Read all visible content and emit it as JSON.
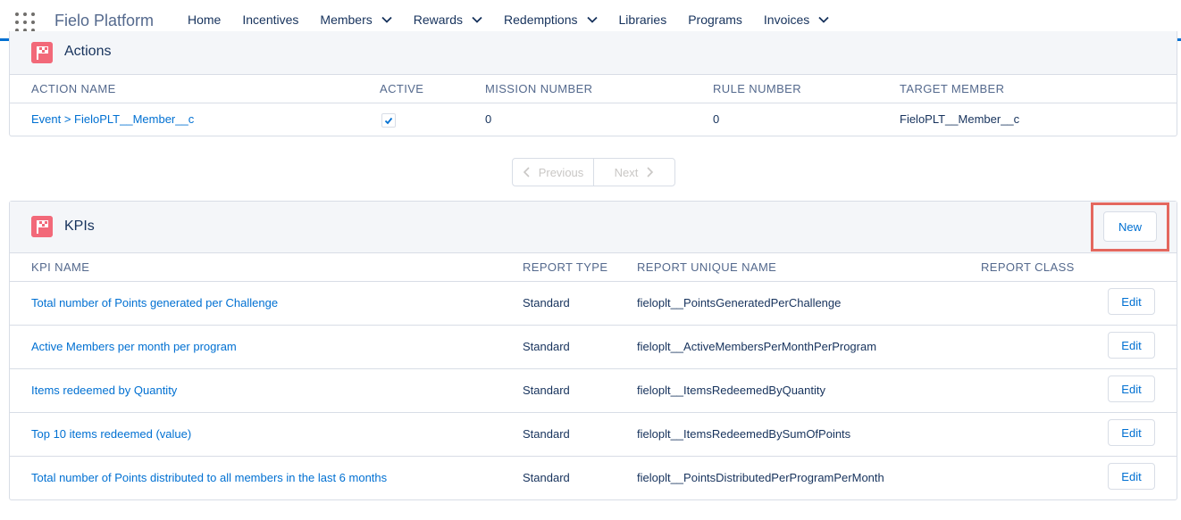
{
  "header": {
    "app_name": "Fielo Platform",
    "nav": [
      {
        "label": "Home",
        "has_dropdown": false
      },
      {
        "label": "Incentives",
        "has_dropdown": false
      },
      {
        "label": "Members",
        "has_dropdown": true
      },
      {
        "label": "Rewards",
        "has_dropdown": true
      },
      {
        "label": "Redemptions",
        "has_dropdown": true
      },
      {
        "label": "Libraries",
        "has_dropdown": false
      },
      {
        "label": "Programs",
        "has_dropdown": false
      },
      {
        "label": "Invoices",
        "has_dropdown": true
      }
    ]
  },
  "actions": {
    "title": "Actions",
    "columns": [
      "ACTION NAME",
      "ACTIVE",
      "MISSION NUMBER",
      "RULE NUMBER",
      "TARGET MEMBER"
    ],
    "rows": [
      {
        "name": "Event > FieloPLT__Member__c",
        "active": true,
        "mission": "0",
        "rule": "0",
        "target": "FieloPLT__Member__c"
      }
    ]
  },
  "pager": {
    "previous": "Previous",
    "next": "Next"
  },
  "kpis": {
    "title": "KPIs",
    "new_label": "New",
    "columns": [
      "KPI NAME",
      "REPORT TYPE",
      "REPORT UNIQUE NAME",
      "REPORT CLASS"
    ],
    "rows": [
      {
        "name": "Total number of Points generated per Challenge",
        "type": "Standard",
        "unique": "fieloplt__PointsGeneratedPerChallenge",
        "cls": "",
        "edit": "Edit"
      },
      {
        "name": "Active Members per month per program",
        "type": "Standard",
        "unique": "fieloplt__ActiveMembersPerMonthPerProgram",
        "cls": "",
        "edit": "Edit"
      },
      {
        "name": "Items redeemed by Quantity",
        "type": "Standard",
        "unique": "fieloplt__ItemsRedeemedByQuantity",
        "cls": "",
        "edit": "Edit"
      },
      {
        "name": "Top 10 items redeemed (value)",
        "type": "Standard",
        "unique": "fieloplt__ItemsRedeemedBySumOfPoints",
        "cls": "",
        "edit": "Edit"
      },
      {
        "name": "Total number of Points distributed to all members in the last 6 months",
        "type": "Standard",
        "unique": "fieloplt__PointsDistributedPerProgramPerMonth",
        "cls": "",
        "edit": "Edit"
      }
    ]
  },
  "colors": {
    "accent": "#0070d2",
    "icon": "#f26979",
    "highlight": "#e4675e"
  }
}
